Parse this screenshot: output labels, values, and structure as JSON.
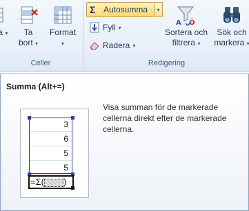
{
  "ribbon": {
    "cells_group": {
      "label": "Celler",
      "insert_partial": "ga",
      "delete_label": "Ta",
      "delete_label2": "bort",
      "format_label": "Format"
    },
    "editing_group": {
      "label": "Redigering",
      "autosum_label": "Autosumma",
      "autosum_symbol": "Σ",
      "fill_label": "Fyll",
      "clear_label": "Radera",
      "sort_label": "Sortera och",
      "sort_label2": "filtrera",
      "find_label": "Sök och",
      "find_label2": "markera"
    },
    "caret": "▾"
  },
  "tooltip": {
    "title": "Summa (Alt+=)",
    "description": "Visa summan för de markerade cellerna direkt efter de markerade cellerna.",
    "example": {
      "values": [
        "3",
        "6",
        "5",
        "5"
      ],
      "formula_prefix": "=Σ(",
      "formula_suffix": ")"
    }
  },
  "colors": {
    "highlight": "#ffd968",
    "selection": "#2b3aa6",
    "ribbon_text": "#1e395b"
  }
}
